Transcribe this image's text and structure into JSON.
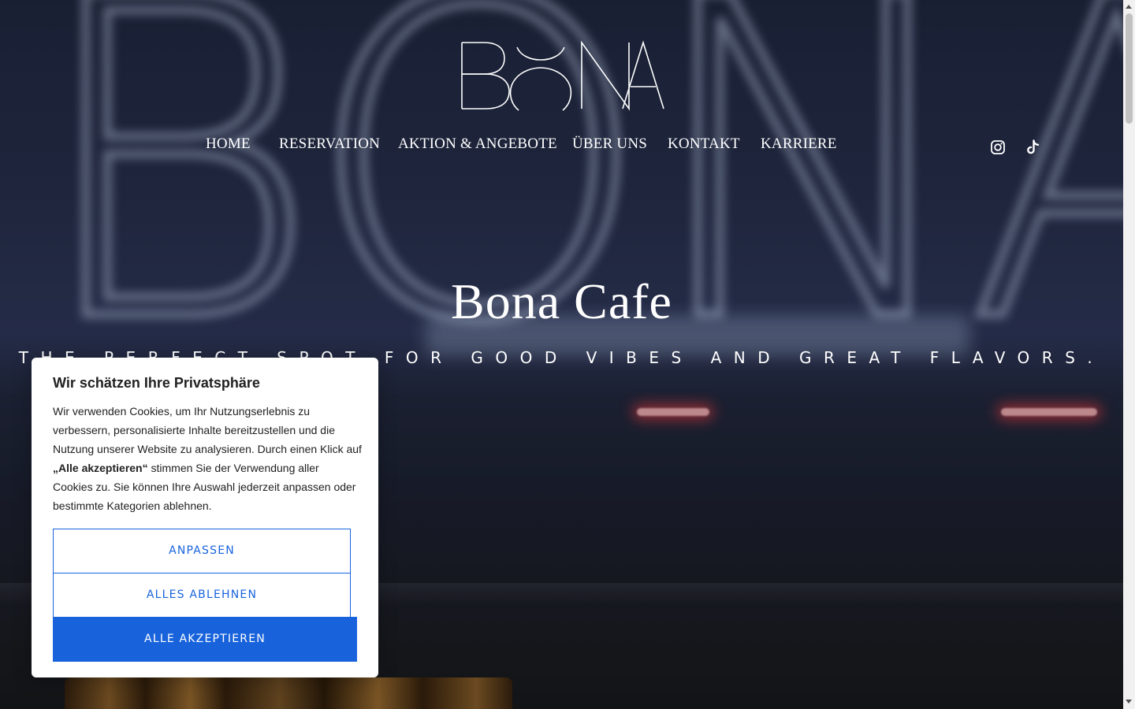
{
  "logo": {
    "text": "BONA"
  },
  "nav": {
    "items": [
      {
        "label": "HOME"
      },
      {
        "label": "RESERVATION"
      },
      {
        "label": "AKTION & ANGEBOTE"
      },
      {
        "label": "ÜBER UNS"
      },
      {
        "label": "KONTAKT"
      },
      {
        "label": "KARRIERE"
      }
    ],
    "social": [
      "instagram-icon",
      "tiktok-icon"
    ]
  },
  "hero": {
    "title": "Bona Cafe",
    "tagline": "THE PERFECT SPOT FOR GOOD VIBES AND GREAT FLAVORS."
  },
  "cookie_banner": {
    "title": "Wir schätzen Ihre Privatsphäre",
    "text_before": "Wir verwenden Cookies, um Ihr Nutzungserlebnis zu verbessern, personalisierte Inhalte bereitzustellen und die Nutzung unserer Website zu analysieren. Durch einen Klick auf ",
    "text_bold": "„Alle akzeptieren“",
    "text_after": " stimmen Sie der Verwendung aller Cookies zu. Sie können Ihre Auswahl jederzeit anpassen oder bestimmte Kategorien ablehnen.",
    "customize_label": "ANPASSEN",
    "reject_label": "ALLES ABLEHNEN",
    "accept_label": "ALLE AKZEPTIEREN"
  },
  "colors": {
    "accent": "#1863dc",
    "text_dark": "#212121",
    "white": "#ffffff"
  }
}
